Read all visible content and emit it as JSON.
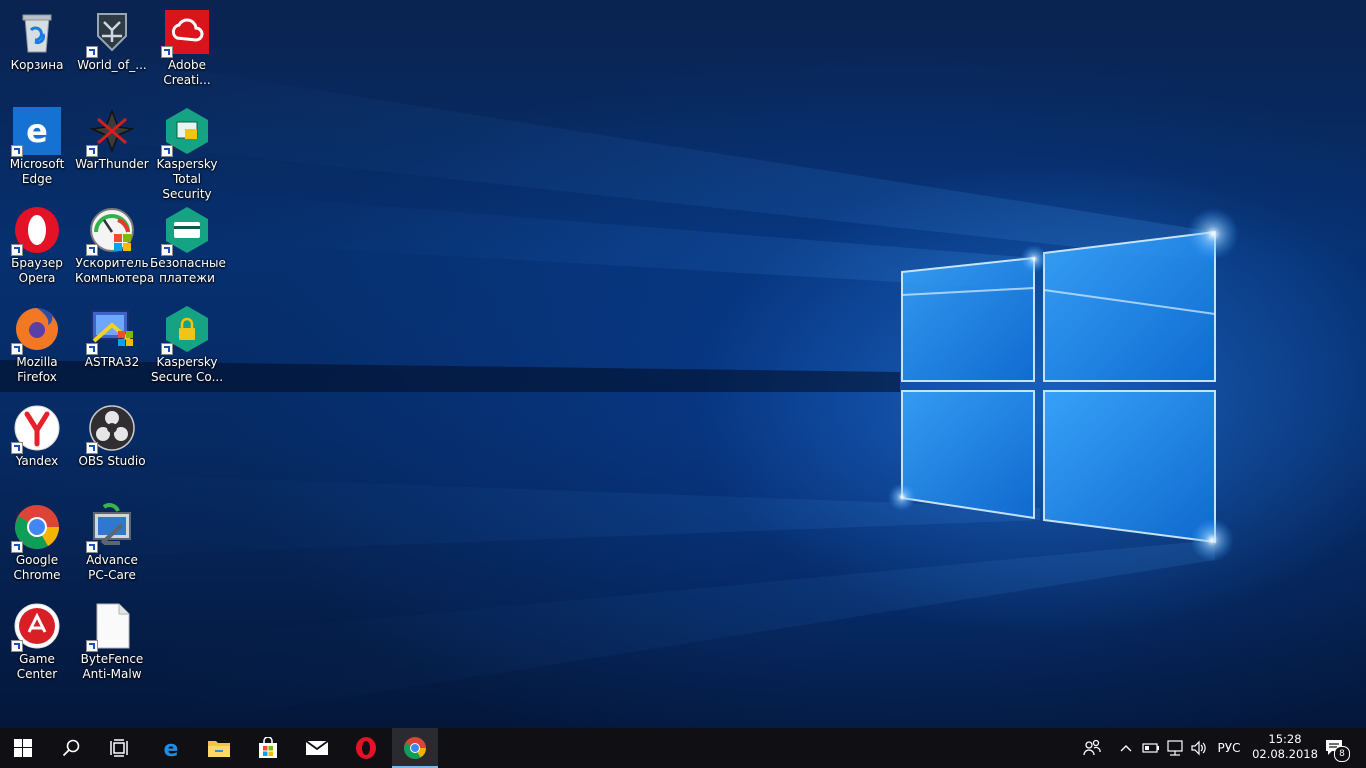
{
  "desktop": {
    "icons": [
      {
        "id": "recycle-bin",
        "label": "Корзина",
        "icon": "recycle-bin-icon"
      },
      {
        "id": "world-of-warships",
        "label": "World_of_...",
        "icon": "warships-icon"
      },
      {
        "id": "adobe-cc",
        "label": "Adobe Creati...",
        "icon": "adobe-creative-cloud-icon"
      },
      {
        "id": "edge",
        "label": "Microsoft Edge",
        "icon": "edge-icon"
      },
      {
        "id": "warthunder",
        "label": "WarThunder",
        "icon": "warthunder-icon"
      },
      {
        "id": "kaspersky-ts",
        "label": "Kaspersky Total Security",
        "icon": "kaspersky-total-security-icon"
      },
      {
        "id": "opera",
        "label": "Браузер Opera",
        "icon": "opera-icon"
      },
      {
        "id": "pc-accelerator",
        "label": "Ускоритель Компьютера",
        "icon": "speedometer-icon"
      },
      {
        "id": "safe-payments",
        "label": "Безопасные платежи",
        "icon": "safe-payments-icon"
      },
      {
        "id": "firefox",
        "label": "Mozilla Firefox",
        "icon": "firefox-icon"
      },
      {
        "id": "astra32",
        "label": "ASTRA32",
        "icon": "astra32-icon"
      },
      {
        "id": "kaspersky-sc",
        "label": "Kaspersky Secure Co...",
        "icon": "kaspersky-secure-connection-icon"
      },
      {
        "id": "yandex",
        "label": "Yandex",
        "icon": "yandex-icon"
      },
      {
        "id": "obs",
        "label": "OBS Studio",
        "icon": "obs-icon"
      },
      {
        "id": "chrome",
        "label": "Google Chrome",
        "icon": "chrome-icon"
      },
      {
        "id": "advance-pc-care",
        "label": "Advance PC-Care",
        "icon": "pc-care-icon"
      },
      {
        "id": "game-center",
        "label": "Game Center",
        "icon": "game-center-icon"
      },
      {
        "id": "bytefence",
        "label": "ByteFence Anti-Malw",
        "icon": "blank-file-icon"
      }
    ]
  },
  "taskbar": {
    "buttons": [
      {
        "id": "start",
        "icon": "windows-logo-icon"
      },
      {
        "id": "search",
        "icon": "search-icon"
      },
      {
        "id": "task-view",
        "icon": "task-view-icon"
      },
      {
        "id": "edge",
        "icon": "edge-icon"
      },
      {
        "id": "explorer",
        "icon": "folder-icon"
      },
      {
        "id": "store",
        "icon": "store-icon"
      },
      {
        "id": "mail",
        "icon": "mail-icon"
      },
      {
        "id": "opera",
        "icon": "opera-icon"
      },
      {
        "id": "chrome",
        "icon": "chrome-icon",
        "active": true
      }
    ],
    "tray": {
      "language": "РУС",
      "time": "15:28",
      "date": "02.08.2018",
      "notification_count": "8"
    }
  },
  "colors": {
    "taskbar_bg": "#0f0f14",
    "active_indicator": "#76b9ed",
    "wallpaper_glow": "#2f9bff"
  }
}
